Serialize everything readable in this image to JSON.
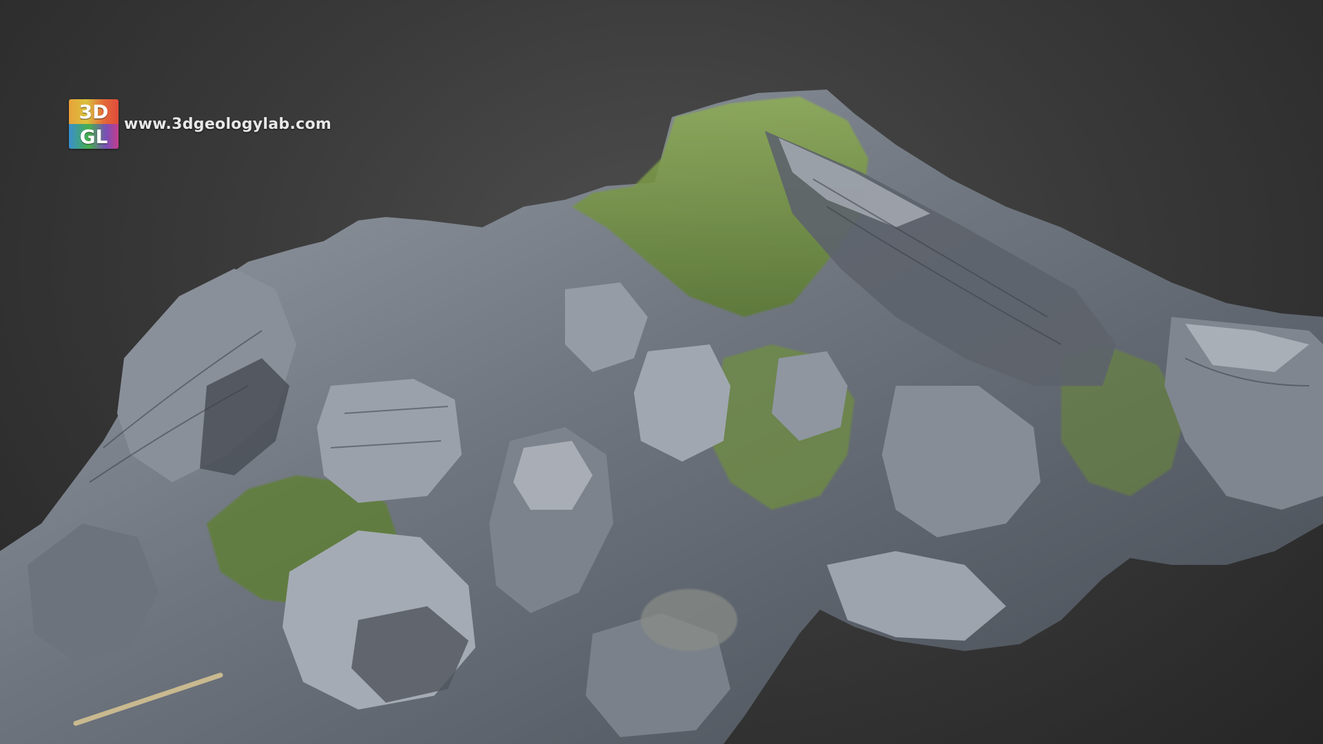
{
  "branding": {
    "logo_line1": "3D",
    "logo_line2": "GL",
    "url": "www.3dgeologylab.com"
  },
  "model": {
    "icon": "3d-rock-outcrop-model",
    "colors": {
      "background_center": "#4e4e4e",
      "background_edge": "#262626",
      "rock_light": "#b9bec6",
      "rock_mid": "#7e8590",
      "rock_dark": "#3e434b",
      "vegetation": "#7d9a45",
      "vegetation_dark": "#4f6b2a"
    }
  }
}
